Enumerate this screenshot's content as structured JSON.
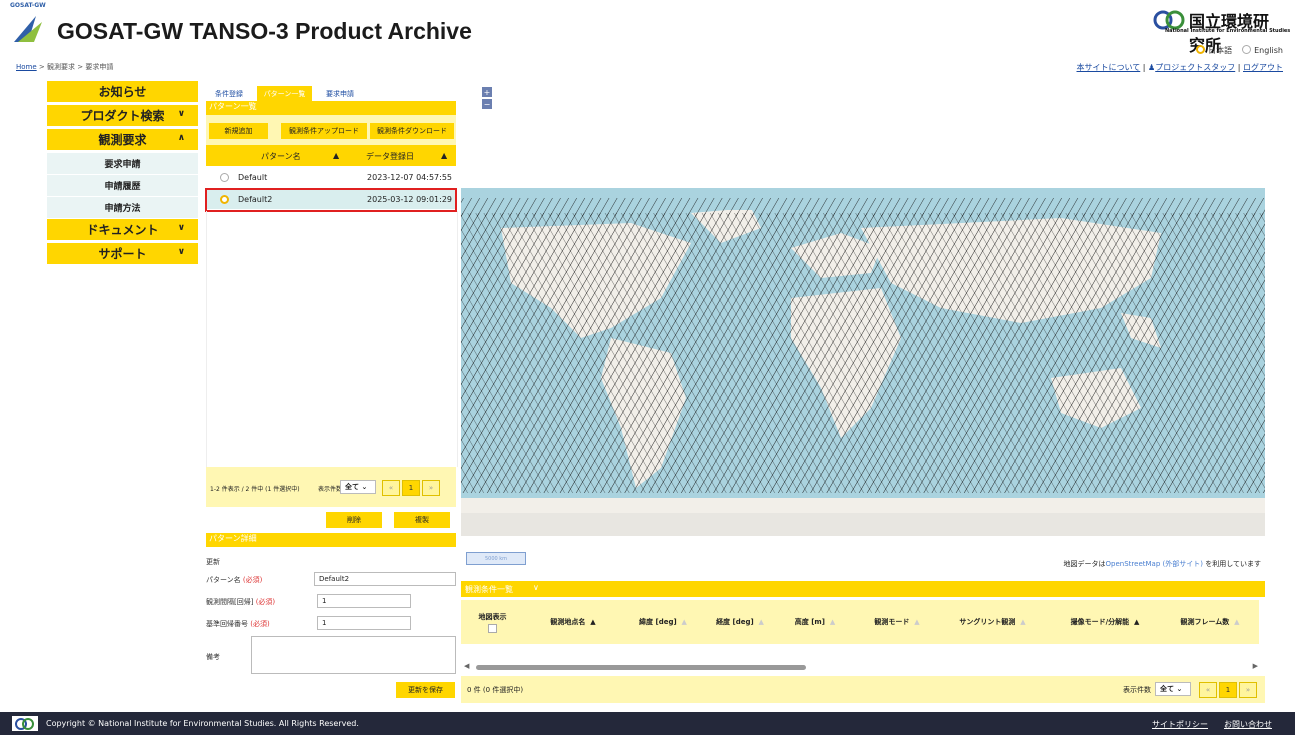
{
  "header": {
    "logo_text": "GOSAT-GW",
    "title": "GOSAT-GW TANSO-3 Product Archive",
    "nies_name": "国立環境研究所",
    "nies_sub": "National Institute for Environmental Studies",
    "lang_ja": "日本語",
    "lang_en": "English",
    "about": "本サイトについて",
    "staff": "プロジェクトスタッフ",
    "logout": "ログアウト",
    "sep": " | "
  },
  "breadcrumb": {
    "home": "Home",
    "sep1": " > ",
    "level2": "観測要求",
    "sep2": " > ",
    "current": "要求申請"
  },
  "sidebar": {
    "items": [
      {
        "label": "お知らせ"
      },
      {
        "label": "プロダクト検索",
        "chevron": "∨"
      },
      {
        "label": "観測要求",
        "chevron": "∧"
      },
      {
        "label": "要求申請"
      },
      {
        "label": "申請履歴"
      },
      {
        "label": "申請方法"
      },
      {
        "label": "ドキュメント",
        "chevron": "∨"
      },
      {
        "label": "サポート",
        "chevron": "∨"
      }
    ]
  },
  "panel": {
    "tabs": [
      "条件登録",
      "パターン一覧",
      "要求申請"
    ],
    "section_title": "パターン一覧",
    "buttons": {
      "new": "新規追加",
      "upload": "観測条件アップロード",
      "download": "観測条件ダウンロード"
    },
    "columns": {
      "name": "パターン名",
      "date": "データ登録日",
      "sort": "▲"
    },
    "rows": [
      {
        "name": "Default",
        "date": "2023-12-07 04:57:55",
        "selected": false
      },
      {
        "name": "Default2",
        "date": "2025-03-12 09:01:29",
        "selected": true
      }
    ],
    "pager": {
      "info": "1-2 件表示 / 2 件中 (1 件選択中)",
      "per_page_label": "表示件数",
      "per_page": "全て",
      "prev": "«",
      "page": "1",
      "next": "»"
    },
    "delete": "削除",
    "copy": "複製"
  },
  "detail": {
    "title": "パターン詳細",
    "mode": "更新",
    "name_label": "パターン名",
    "interval_label": "観測間隔[回帰]",
    "ref_label": "基準回帰番号",
    "required": "(必須)",
    "name_value": "Default2",
    "interval_value": "1",
    "ref_value": "1",
    "note_label": "備考",
    "save": "更新を保存"
  },
  "map": {
    "zoom_in": "+",
    "zoom_out": "−",
    "scale": "5000 km",
    "credit_pre": "地図データは",
    "credit_link": "OpenStreetMap (外部サイト)",
    "credit_post": " を利用しています"
  },
  "obs_table": {
    "title": "観測条件一覧",
    "chevron": "∨",
    "columns": [
      "地図表示",
      "観測地点名",
      "緯度 [deg]",
      "経度 [deg]",
      "高度 [m]",
      "観測モード",
      "サングリント観測",
      "撮像モード/分解能",
      "観測フレーム数"
    ],
    "sort": "▲",
    "count": "0 件 (0 件選択中)",
    "per_page_label": "表示件数",
    "per_page": "全て",
    "prev": "«",
    "page": "1",
    "next": "»"
  },
  "footer": {
    "copyright": "Copyright © National Institute for Environmental Studies. All Rights Reserved.",
    "policy": "サイトポリシー",
    "contact": "お問い合わせ"
  },
  "colors": {
    "accent": "#ffd600",
    "light_accent": "#fff7b3",
    "ocean": "#aad3df",
    "land": "#f2efe9",
    "footer": "#24283a",
    "highlight": "#e02020"
  }
}
